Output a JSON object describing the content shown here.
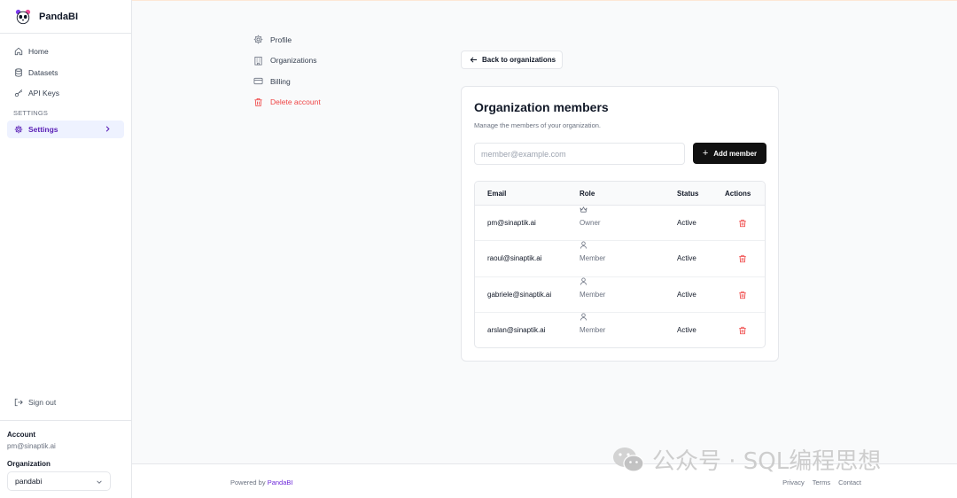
{
  "app": {
    "name": "PandaBI"
  },
  "sidebar": {
    "items": [
      {
        "label": "Home",
        "icon": "home-icon"
      },
      {
        "label": "Datasets",
        "icon": "database-icon"
      },
      {
        "label": "API Keys",
        "icon": "key-icon"
      }
    ],
    "section_label": "SETTINGS",
    "active_item": {
      "label": "Settings",
      "icon": "gear-icon"
    },
    "sign_out": "Sign out",
    "account_label": "Account",
    "account_email": "pm@sinaptik.ai",
    "organization_label": "Organization",
    "organization_value": "pandabi"
  },
  "settings_nav": [
    {
      "label": "Profile",
      "icon": "gear-icon"
    },
    {
      "label": "Organizations",
      "icon": "building-icon"
    },
    {
      "label": "Billing",
      "icon": "credit-card-icon"
    },
    {
      "label": "Delete account",
      "icon": "trash-icon"
    }
  ],
  "back_button": "Back to organizations",
  "card": {
    "title": "Organization members",
    "description": "Manage the members of your organization.",
    "input_placeholder": "member@example.com",
    "add_button": "Add member",
    "columns": [
      "Email",
      "Role",
      "Status",
      "Actions"
    ],
    "rows": [
      {
        "email": "pm@sinaptik.ai",
        "role": "Owner",
        "status": "Active"
      },
      {
        "email": "raoul@sinaptik.ai",
        "role": "Member",
        "status": "Active"
      },
      {
        "email": "gabriele@sinaptik.ai",
        "role": "Member",
        "status": "Active"
      },
      {
        "email": "arslan@sinaptik.ai",
        "role": "Member",
        "status": "Active"
      }
    ]
  },
  "footer": {
    "powered_prefix": "Powered by",
    "powered_brand": "PandaBI",
    "links": [
      "Privacy",
      "Terms",
      "Contact"
    ]
  },
  "watermark": "公众号 · SQL编程思想",
  "colors": {
    "accent": "#6d28d9",
    "danger": "#ef4444",
    "primary_button": "#111111"
  }
}
